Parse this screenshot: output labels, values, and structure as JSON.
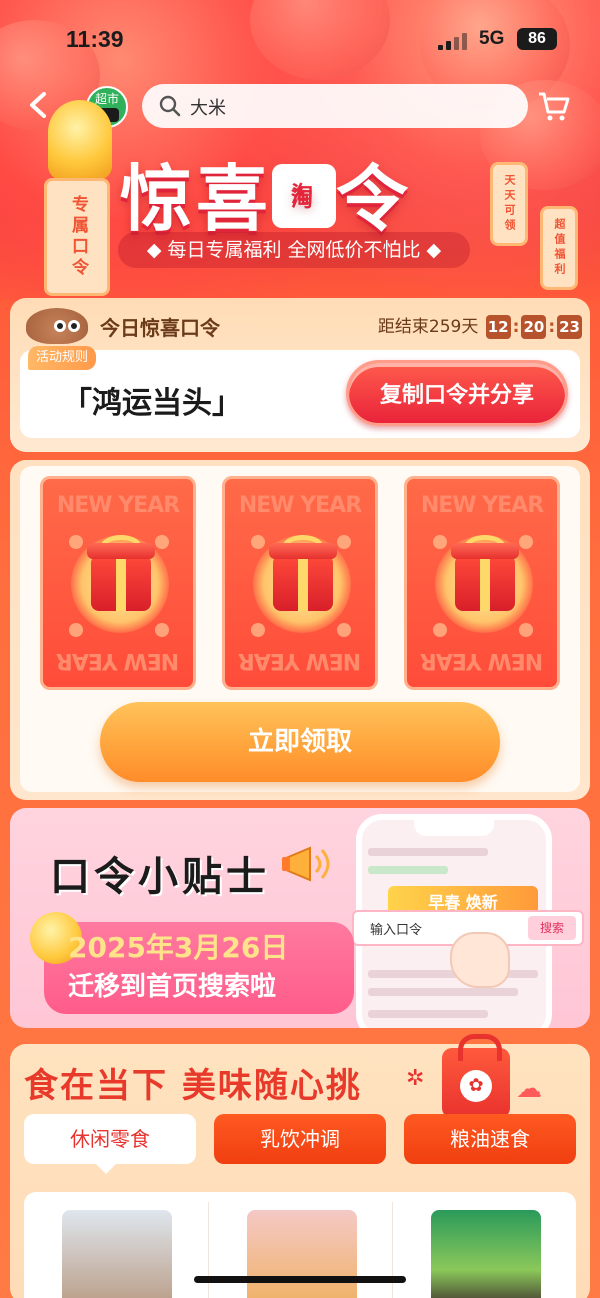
{
  "status_bar": {
    "time": "11:39",
    "network": "5G",
    "battery": "86"
  },
  "nav": {
    "badge": "超市",
    "search_placeholder": "大米"
  },
  "hero": {
    "title_part1": "惊喜",
    "seal_text": "淘",
    "title_part2": "令",
    "title_mid": "口",
    "subtitle": "◆ 每日专属福利 全网低价不怕比 ◆",
    "tag_left": "专属口令",
    "tag_right1": "天天可领",
    "tag_right2": "超值福利"
  },
  "daily_code": {
    "title": "今日惊喜口令",
    "countdown_label": "距结束259天",
    "hours": "12",
    "minutes": "20",
    "seconds": "23",
    "rules_tag": "活动规则",
    "code": "「鸿运当头」",
    "copy_button": "复制口令并分享"
  },
  "envelopes": {
    "label": "NEW YEAR",
    "count": 3,
    "claim_button": "立即领取"
  },
  "tips": {
    "title": "口令小贴士",
    "line1": "2025年3月26日",
    "line2": "迁移到首页搜索啦",
    "phone_banner": "早春 焕新",
    "phone_search_placeholder": "输入口令",
    "phone_search_button": "搜索"
  },
  "food": {
    "title": "食在当下 美味随心挑",
    "tabs": [
      {
        "label": "休闲零食",
        "active": true
      },
      {
        "label": "乳饮冲调",
        "active": false
      },
      {
        "label": "粮油速食",
        "active": false
      }
    ]
  },
  "colors": {
    "brand_red": "#e8322e",
    "accent_orange": "#ff8c2a",
    "countdown": "#b6522c"
  }
}
